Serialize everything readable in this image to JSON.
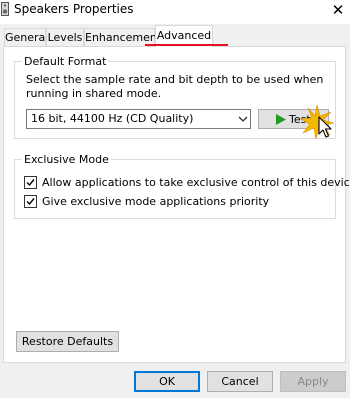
{
  "window": {
    "title": "Speakers Properties",
    "close_glyph": "✕"
  },
  "tabs": [
    {
      "label": "General",
      "active": false
    },
    {
      "label": "Levels",
      "active": false
    },
    {
      "label": "Enhancements",
      "active": false
    },
    {
      "label": "Advanced",
      "active": true
    }
  ],
  "default_format": {
    "group_label": "Default Format",
    "description": "Select the sample rate and bit depth to be used when running in shared mode.",
    "selected_format": "16 bit, 44100 Hz (CD Quality)",
    "test_label": "Test"
  },
  "exclusive_mode": {
    "group_label": "Exclusive Mode",
    "options": [
      {
        "label": "Allow applications to take exclusive control of this device",
        "checked": true
      },
      {
        "label": "Give exclusive mode applications priority",
        "checked": true
      }
    ]
  },
  "buttons": {
    "restore_defaults": "Restore Defaults",
    "ok": "OK",
    "cancel": "Cancel",
    "apply": "Apply"
  },
  "colors": {
    "tab_highlight": "#e81123",
    "test_arrow": "#1e9e1e",
    "cursor_burst": "#f5b800",
    "focus_border": "#0078d7"
  },
  "icons": {
    "title": "speaker-icon",
    "test": "play-icon",
    "combo": "chevron-down-icon",
    "cursor": "mouse-pointer-icon"
  }
}
